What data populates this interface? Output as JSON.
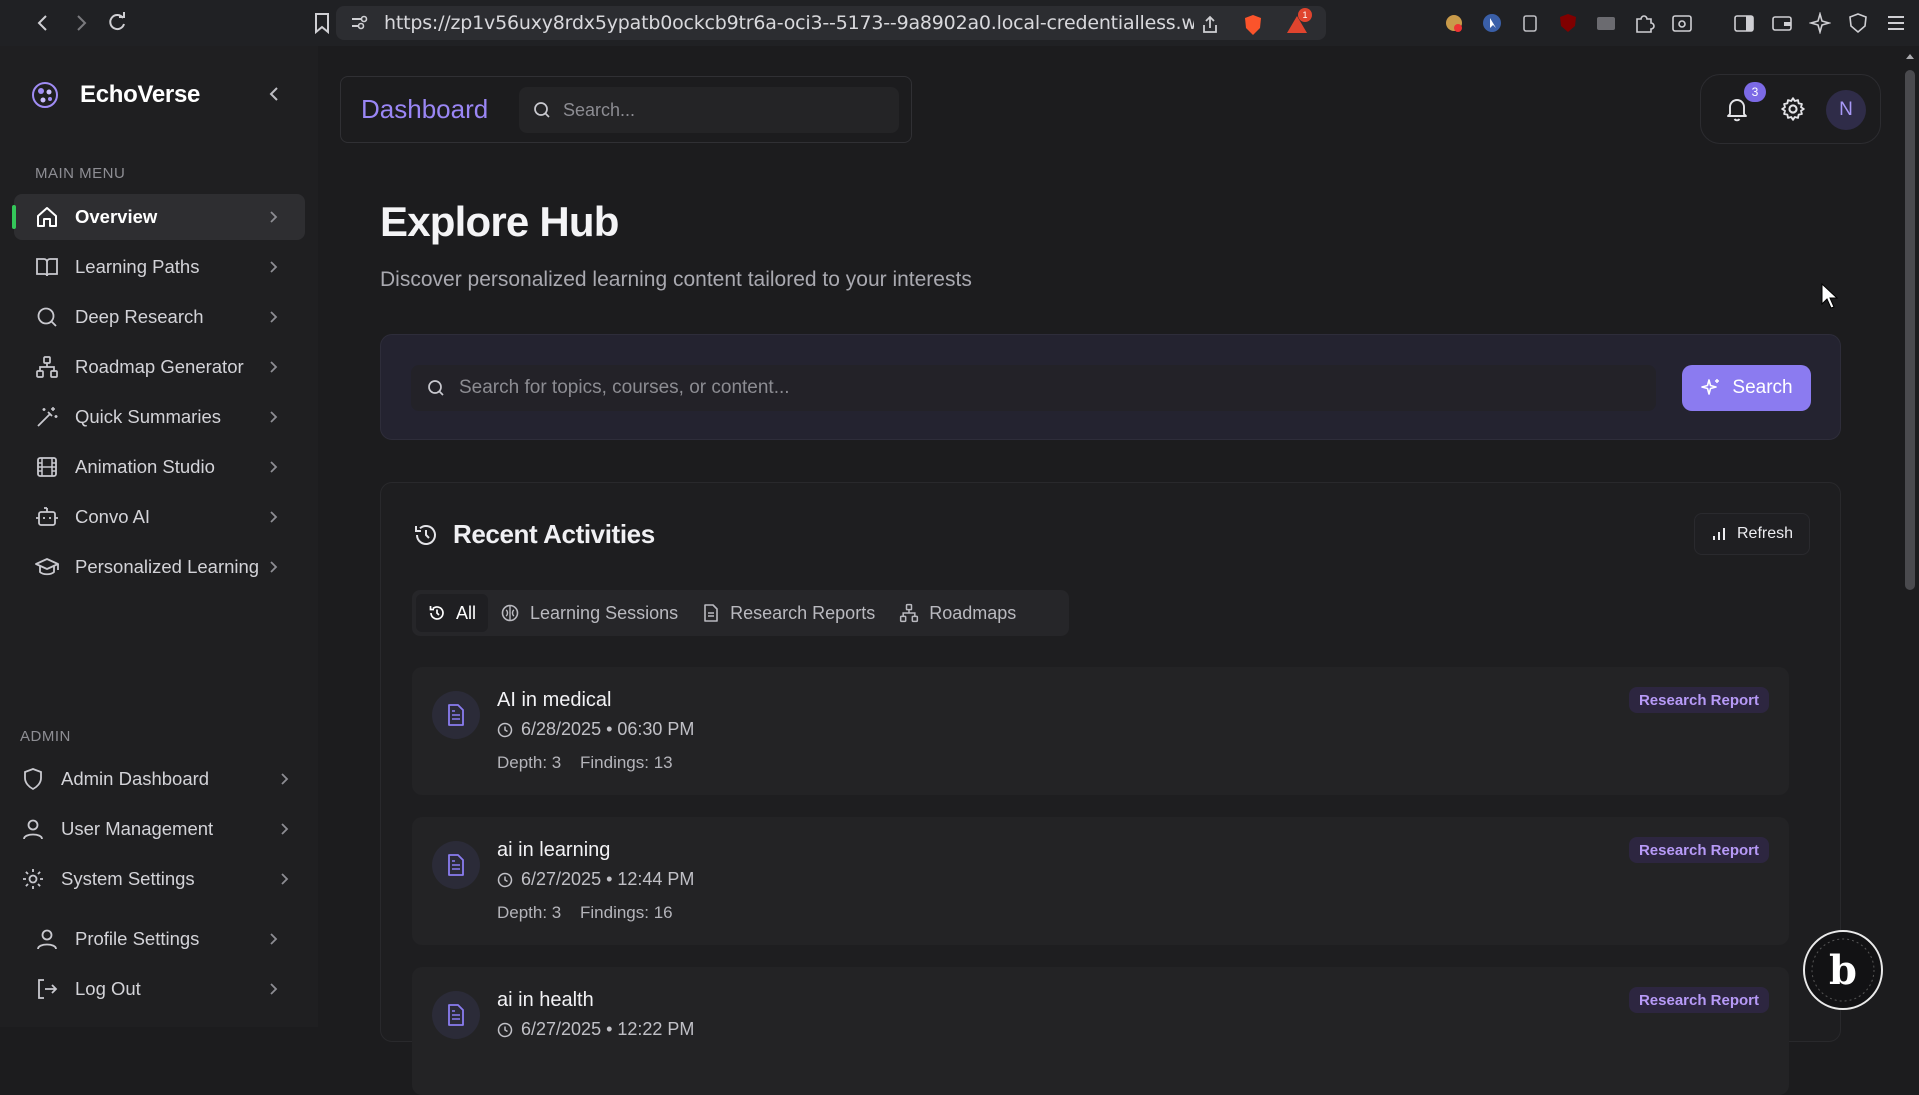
{
  "browser": {
    "url": "https://zp1v56uxy8rdx5ypatb0ockcb9tr6a-oci3--5173--9a8902a0.local-credentialless.webcontainer-api...",
    "alert_count": "1"
  },
  "sidebar": {
    "brand": "EchoVerse",
    "main_menu_label": "MAIN MENU",
    "main_items": [
      {
        "label": "Overview"
      },
      {
        "label": "Learning Paths"
      },
      {
        "label": "Deep Research"
      },
      {
        "label": "Roadmap Generator"
      },
      {
        "label": "Quick Summaries"
      },
      {
        "label": "Animation Studio"
      },
      {
        "label": "Convo AI"
      },
      {
        "label": "Personalized Learning"
      }
    ],
    "admin_label": "ADMIN",
    "admin_items": [
      {
        "label": "Admin Dashboard"
      },
      {
        "label": "User Management"
      },
      {
        "label": "System Settings"
      }
    ],
    "bottom_items": [
      {
        "label": "Profile Settings"
      },
      {
        "label": "Log Out"
      }
    ]
  },
  "topbar": {
    "title": "Dashboard",
    "search_placeholder": "Search...",
    "notification_count": "3",
    "avatar_initial": "N"
  },
  "hero": {
    "title": "Explore Hub",
    "subtitle": "Discover personalized learning content tailored to your interests",
    "search_placeholder": "Search for topics, courses, or content...",
    "search_button": "Search"
  },
  "recent": {
    "title": "Recent Activities",
    "refresh_label": "Refresh",
    "tabs": [
      {
        "label": "All"
      },
      {
        "label": "Learning Sessions"
      },
      {
        "label": "Research Reports"
      },
      {
        "label": "Roadmaps"
      }
    ],
    "activities": [
      {
        "name": "AI in medical",
        "date": "6/28/2025 • 06:30 PM",
        "depth": "Depth: 3",
        "findings": "Findings: 13",
        "tag": "Research Report"
      },
      {
        "name": "ai in learning",
        "date": "6/27/2025 • 12:44 PM",
        "depth": "Depth: 3",
        "findings": "Findings: 16",
        "tag": "Research Report"
      },
      {
        "name": "ai in health",
        "date": "6/27/2025 • 12:22 PM",
        "depth": "",
        "findings": "",
        "tag": "Research Report"
      }
    ]
  },
  "colors": {
    "accent": "#8b7bf0",
    "active_indicator": "#34c759",
    "tag_text": "#b79af7"
  }
}
